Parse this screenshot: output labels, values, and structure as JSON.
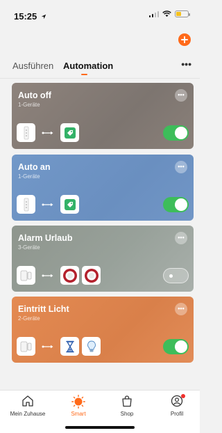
{
  "status_bar": {
    "time": "15:25"
  },
  "header": {
    "add_icon": "plus-icon",
    "more_label": "•••"
  },
  "tabs": [
    {
      "label": "Ausführen",
      "active": false
    },
    {
      "label": "Automation",
      "active": true
    }
  ],
  "cards": [
    {
      "title": "Auto off",
      "subtitle": "1-Geräte",
      "more": "•••",
      "color": "#8b7f78",
      "enabled": true,
      "trigger_icon": "door-sensor-icon",
      "actions": [
        "tag-icon"
      ]
    },
    {
      "title": "Auto an",
      "subtitle": "1-Geräte",
      "more": "•••",
      "color": "#6f93c4",
      "enabled": true,
      "trigger_icon": "door-sensor-icon",
      "actions": [
        "tag-icon"
      ]
    },
    {
      "title": "Alarm Urlaub",
      "subtitle": "3-Geräte",
      "more": "•••",
      "color": "#8f968e",
      "enabled": false,
      "trigger_icon": "contact-sensor-icon",
      "actions": [
        "alarm-siren-icon",
        "alarm-siren-icon"
      ]
    },
    {
      "title": "Eintritt Licht",
      "subtitle": "2-Geräte",
      "more": "•••",
      "color": "#e0864f",
      "enabled": true,
      "trigger_icon": "contact-sensor-icon",
      "actions": [
        "hourglass-icon",
        "light-bulb-icon"
      ]
    }
  ],
  "tabbar": [
    {
      "label": "Mein Zuhause",
      "icon": "home-icon",
      "active": false
    },
    {
      "label": "Smart",
      "icon": "sun-icon",
      "active": true
    },
    {
      "label": "Shop",
      "icon": "shopping-bag-icon",
      "active": false
    },
    {
      "label": "Profil",
      "icon": "profile-icon",
      "active": false,
      "badge": true
    }
  ],
  "colors": {
    "accent": "#ff6a1a",
    "toggle_on": "#3dbd5a"
  }
}
